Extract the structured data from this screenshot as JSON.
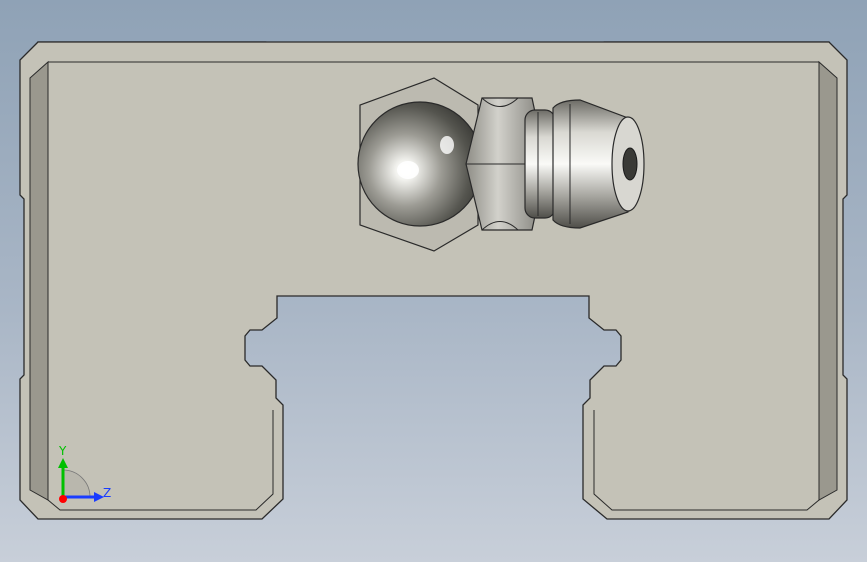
{
  "viewport": {
    "background_top": "#8fa2b6",
    "background_bottom": "#c8cfd9"
  },
  "part": {
    "body_color": "#c4c2b7",
    "edge_color": "#2a2a2a",
    "chamfer_color": "#9a988e",
    "fitting_color": "#b8b8b0"
  },
  "triad": {
    "y_label": "Y",
    "z_label": "Z",
    "y_color": "#00c000",
    "z_color": "#1a3cff",
    "x_color": "#ff0000"
  }
}
